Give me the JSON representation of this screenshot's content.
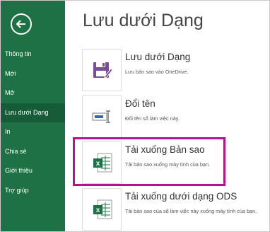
{
  "sidebar": {
    "back_icon": "back-arrow-circle-icon",
    "items": [
      {
        "label": "Thông tin"
      },
      {
        "label": "Mới"
      },
      {
        "label": "Mở"
      },
      {
        "label": "Lưu dưới Dạng"
      },
      {
        "label": "In"
      },
      {
        "label": "Chia sẻ"
      },
      {
        "label": "Giới thiệu"
      },
      {
        "label": "Trợ giúp"
      }
    ],
    "active_index": 3
  },
  "main": {
    "title": "Lưu dưới Dạng",
    "options": [
      {
        "title": "Lưu dưới Dạng",
        "description": "Lưu bản sao vào OneDrive.",
        "icon": "floppy-pencil-icon"
      },
      {
        "title": "Đổi tên",
        "description": "Đổi tên sổ làm việc này.",
        "icon": "rename-textbox-icon"
      },
      {
        "title": "Tải xuống Bản sao",
        "description": "Tải bản sao xuống máy tính của bạn.",
        "icon": "excel-file-icon"
      },
      {
        "title": "Tải xuống dưới dạng ODS",
        "description": "Tải bản sao của sổ làm việc này xuống máy tính của bạn.",
        "icon": "excel-file-icon"
      }
    ]
  },
  "colors": {
    "sidebar_bg": "#1e7145",
    "sidebar_active": "#165c38",
    "highlight_border": "#b5128f",
    "save_icon": "#7b4c9c",
    "excel_green": "#1e7145"
  }
}
